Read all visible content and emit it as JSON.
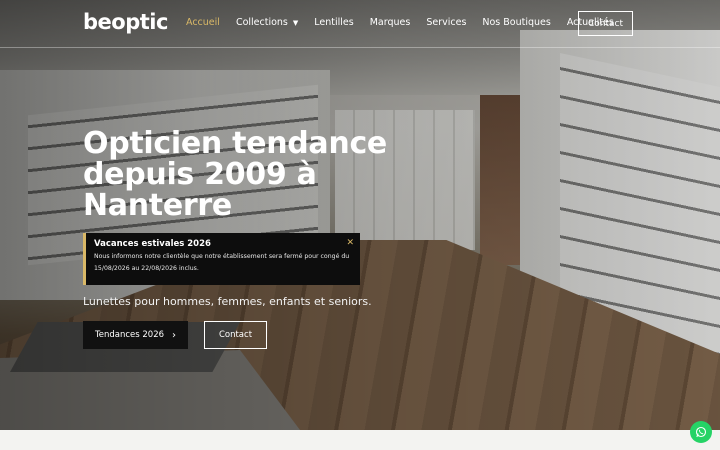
{
  "brand": {
    "logo_text": "beoptic"
  },
  "nav": {
    "items": [
      {
        "label": "Accueil",
        "active": true
      },
      {
        "label": "Collections",
        "has_dropdown": true
      },
      {
        "label": "Lentilles"
      },
      {
        "label": "Marques"
      },
      {
        "label": "Services"
      },
      {
        "label": "Nos Boutiques"
      },
      {
        "label": "Actualités"
      }
    ],
    "contact_label": "Contact"
  },
  "hero": {
    "title": "Opticien tendance depuis 2009 à Nanterre",
    "subtitle": "Lunettes pour hommes, femmes, enfants et seniors.",
    "primary_button": "Tendances 2026",
    "secondary_button": "Contact"
  },
  "notice": {
    "title": "Vacances estivales 2026",
    "text": "Nous informons notre clientèle que notre établissement sera fermé pour congé du 15/08/2026 au 22/08/2026 inclus.",
    "close_icon": "close-icon"
  },
  "colors": {
    "accent": "#d9b867",
    "dark": "#111111",
    "whatsapp": "#25d366"
  },
  "icons": {
    "whatsapp": "whatsapp-icon",
    "arrow": "chevron-right-icon",
    "dropdown": "chevron-down-icon"
  }
}
